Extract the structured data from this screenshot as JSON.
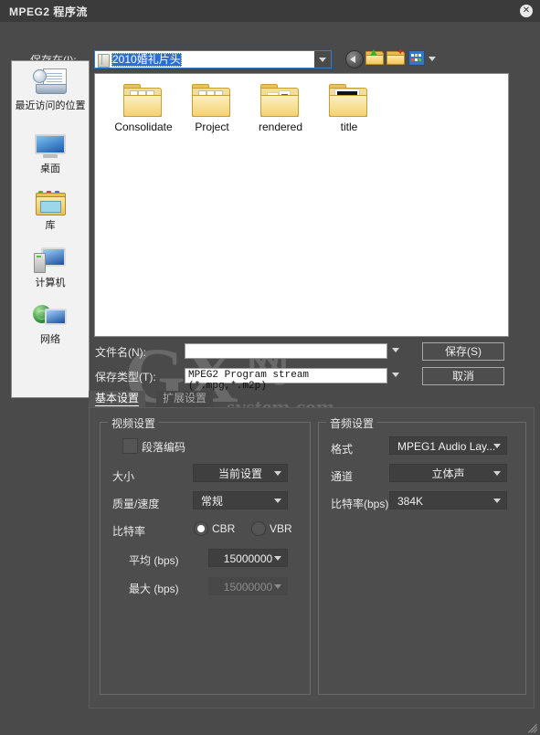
{
  "window": {
    "title": "MPEG2 程序流",
    "close_label": "✕"
  },
  "file_dialog": {
    "save_in_label": "保存在(I):",
    "current_folder": "2010婚礼片头",
    "toolbar": {
      "back_icon": "back-arrow-icon",
      "up_icon": "up-folder-icon",
      "new_folder_icon": "new-folder-icon",
      "views_icon": "views-icon"
    },
    "places": [
      {
        "label": "最近访问的位置",
        "icon": "recent-places-icon"
      },
      {
        "label": "桌面",
        "icon": "desktop-icon"
      },
      {
        "label": "库",
        "icon": "library-icon"
      },
      {
        "label": "计算机",
        "icon": "computer-icon"
      },
      {
        "label": "网络",
        "icon": "network-icon"
      }
    ],
    "files": [
      {
        "name": "Consolidate",
        "icon": "folder-icon"
      },
      {
        "name": "Project",
        "icon": "folder-icon"
      },
      {
        "name": "rendered",
        "icon": "folder-photos-icon"
      },
      {
        "name": "title",
        "icon": "folder-film-icon"
      }
    ],
    "filename_label": "文件名(N):",
    "filename_value": "",
    "filetype_label": "保存类型(T):",
    "filetype_value": "MPEG2 Program stream (*.mpg,*.m2p)",
    "save_button": "保存(S)",
    "cancel_button": "取消"
  },
  "watermark": {
    "letters": "GX",
    "cn": "网",
    "domain": "system.com"
  },
  "tabs": [
    {
      "label": "基本设置",
      "active": true
    },
    {
      "label": "扩展设置",
      "active": false
    }
  ],
  "video_settings": {
    "caption": "视频设置",
    "segment_encode_label": "段落编码",
    "segment_encode_checked": false,
    "size_label": "大小",
    "size_value": "当前设置",
    "quality_label": "质量/速度",
    "quality_value": "常规",
    "bitrate_label": "比特率",
    "cbr_label": "CBR",
    "vbr_label": "VBR",
    "bitrate_mode": "CBR",
    "avg_label": "平均 (bps)",
    "avg_value": "15000000",
    "max_label": "最大 (bps)",
    "max_value": "15000000",
    "max_enabled": false
  },
  "audio_settings": {
    "caption": "音频设置",
    "format_label": "格式",
    "format_value": "MPEG1 Audio Lay...",
    "channel_label": "通道",
    "channel_value": "立体声",
    "bitrate_label": "比特率(bps)",
    "bitrate_value": "384K"
  },
  "colors": {
    "window_bg": "#4a4a4a",
    "titlebar": "#3b3b3b",
    "accent_focus": "#2f7fd1",
    "selection": "#2a6fd6",
    "panel": "#4d4d4d",
    "field_dark": "#3f3f3f"
  }
}
